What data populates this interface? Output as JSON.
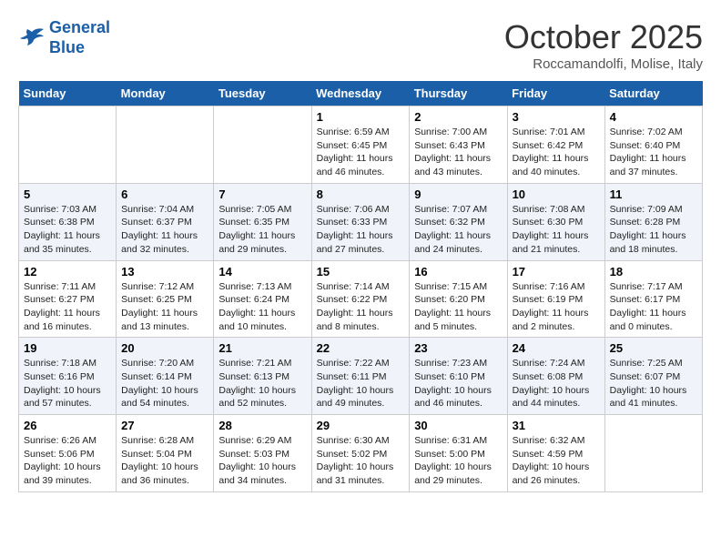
{
  "logo": {
    "line1": "General",
    "line2": "Blue"
  },
  "header": {
    "month": "October 2025",
    "location": "Roccamandolfi, Molise, Italy"
  },
  "weekdays": [
    "Sunday",
    "Monday",
    "Tuesday",
    "Wednesday",
    "Thursday",
    "Friday",
    "Saturday"
  ],
  "weeks": [
    [
      {
        "day": "",
        "info": ""
      },
      {
        "day": "",
        "info": ""
      },
      {
        "day": "",
        "info": ""
      },
      {
        "day": "1",
        "info": "Sunrise: 6:59 AM\nSunset: 6:45 PM\nDaylight: 11 hours and 46 minutes."
      },
      {
        "day": "2",
        "info": "Sunrise: 7:00 AM\nSunset: 6:43 PM\nDaylight: 11 hours and 43 minutes."
      },
      {
        "day": "3",
        "info": "Sunrise: 7:01 AM\nSunset: 6:42 PM\nDaylight: 11 hours and 40 minutes."
      },
      {
        "day": "4",
        "info": "Sunrise: 7:02 AM\nSunset: 6:40 PM\nDaylight: 11 hours and 37 minutes."
      }
    ],
    [
      {
        "day": "5",
        "info": "Sunrise: 7:03 AM\nSunset: 6:38 PM\nDaylight: 11 hours and 35 minutes."
      },
      {
        "day": "6",
        "info": "Sunrise: 7:04 AM\nSunset: 6:37 PM\nDaylight: 11 hours and 32 minutes."
      },
      {
        "day": "7",
        "info": "Sunrise: 7:05 AM\nSunset: 6:35 PM\nDaylight: 11 hours and 29 minutes."
      },
      {
        "day": "8",
        "info": "Sunrise: 7:06 AM\nSunset: 6:33 PM\nDaylight: 11 hours and 27 minutes."
      },
      {
        "day": "9",
        "info": "Sunrise: 7:07 AM\nSunset: 6:32 PM\nDaylight: 11 hours and 24 minutes."
      },
      {
        "day": "10",
        "info": "Sunrise: 7:08 AM\nSunset: 6:30 PM\nDaylight: 11 hours and 21 minutes."
      },
      {
        "day": "11",
        "info": "Sunrise: 7:09 AM\nSunset: 6:28 PM\nDaylight: 11 hours and 18 minutes."
      }
    ],
    [
      {
        "day": "12",
        "info": "Sunrise: 7:11 AM\nSunset: 6:27 PM\nDaylight: 11 hours and 16 minutes."
      },
      {
        "day": "13",
        "info": "Sunrise: 7:12 AM\nSunset: 6:25 PM\nDaylight: 11 hours and 13 minutes."
      },
      {
        "day": "14",
        "info": "Sunrise: 7:13 AM\nSunset: 6:24 PM\nDaylight: 11 hours and 10 minutes."
      },
      {
        "day": "15",
        "info": "Sunrise: 7:14 AM\nSunset: 6:22 PM\nDaylight: 11 hours and 8 minutes."
      },
      {
        "day": "16",
        "info": "Sunrise: 7:15 AM\nSunset: 6:20 PM\nDaylight: 11 hours and 5 minutes."
      },
      {
        "day": "17",
        "info": "Sunrise: 7:16 AM\nSunset: 6:19 PM\nDaylight: 11 hours and 2 minutes."
      },
      {
        "day": "18",
        "info": "Sunrise: 7:17 AM\nSunset: 6:17 PM\nDaylight: 11 hours and 0 minutes."
      }
    ],
    [
      {
        "day": "19",
        "info": "Sunrise: 7:18 AM\nSunset: 6:16 PM\nDaylight: 10 hours and 57 minutes."
      },
      {
        "day": "20",
        "info": "Sunrise: 7:20 AM\nSunset: 6:14 PM\nDaylight: 10 hours and 54 minutes."
      },
      {
        "day": "21",
        "info": "Sunrise: 7:21 AM\nSunset: 6:13 PM\nDaylight: 10 hours and 52 minutes."
      },
      {
        "day": "22",
        "info": "Sunrise: 7:22 AM\nSunset: 6:11 PM\nDaylight: 10 hours and 49 minutes."
      },
      {
        "day": "23",
        "info": "Sunrise: 7:23 AM\nSunset: 6:10 PM\nDaylight: 10 hours and 46 minutes."
      },
      {
        "day": "24",
        "info": "Sunrise: 7:24 AM\nSunset: 6:08 PM\nDaylight: 10 hours and 44 minutes."
      },
      {
        "day": "25",
        "info": "Sunrise: 7:25 AM\nSunset: 6:07 PM\nDaylight: 10 hours and 41 minutes."
      }
    ],
    [
      {
        "day": "26",
        "info": "Sunrise: 6:26 AM\nSunset: 5:06 PM\nDaylight: 10 hours and 39 minutes."
      },
      {
        "day": "27",
        "info": "Sunrise: 6:28 AM\nSunset: 5:04 PM\nDaylight: 10 hours and 36 minutes."
      },
      {
        "day": "28",
        "info": "Sunrise: 6:29 AM\nSunset: 5:03 PM\nDaylight: 10 hours and 34 minutes."
      },
      {
        "day": "29",
        "info": "Sunrise: 6:30 AM\nSunset: 5:02 PM\nDaylight: 10 hours and 31 minutes."
      },
      {
        "day": "30",
        "info": "Sunrise: 6:31 AM\nSunset: 5:00 PM\nDaylight: 10 hours and 29 minutes."
      },
      {
        "day": "31",
        "info": "Sunrise: 6:32 AM\nSunset: 4:59 PM\nDaylight: 10 hours and 26 minutes."
      },
      {
        "day": "",
        "info": ""
      }
    ]
  ]
}
